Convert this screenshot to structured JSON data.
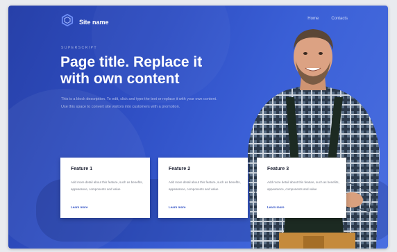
{
  "header": {
    "site_name": "Site name",
    "logo_icon": "hexagon-logo-icon",
    "nav": [
      {
        "label": "Home"
      },
      {
        "label": "Contacts"
      }
    ]
  },
  "hero": {
    "superscript": "SUPERSCRIPT",
    "title": "Page title. Replace it with own content",
    "description": "This is a block description. To edit, click and type the text or replace it with your own content. Use this space to convert site visitors into customers with a promotion."
  },
  "features": [
    {
      "title": "Feature 1",
      "text": "Add more detail about this feature, such as benefits, appearance, components and value",
      "link": "Learn more"
    },
    {
      "title": "Feature 2",
      "text": "Add more detail about this feature, such as benefits, appearance, components and value",
      "link": "Learn more"
    },
    {
      "title": "Feature 3",
      "text": "Add more detail about this feature, such as benefits, appearance, components and value",
      "link": "Learn more"
    }
  ],
  "colors": {
    "accent": "#2f4fc4",
    "hero_bg": "#3a5fd6",
    "card_bg": "#ffffff"
  }
}
